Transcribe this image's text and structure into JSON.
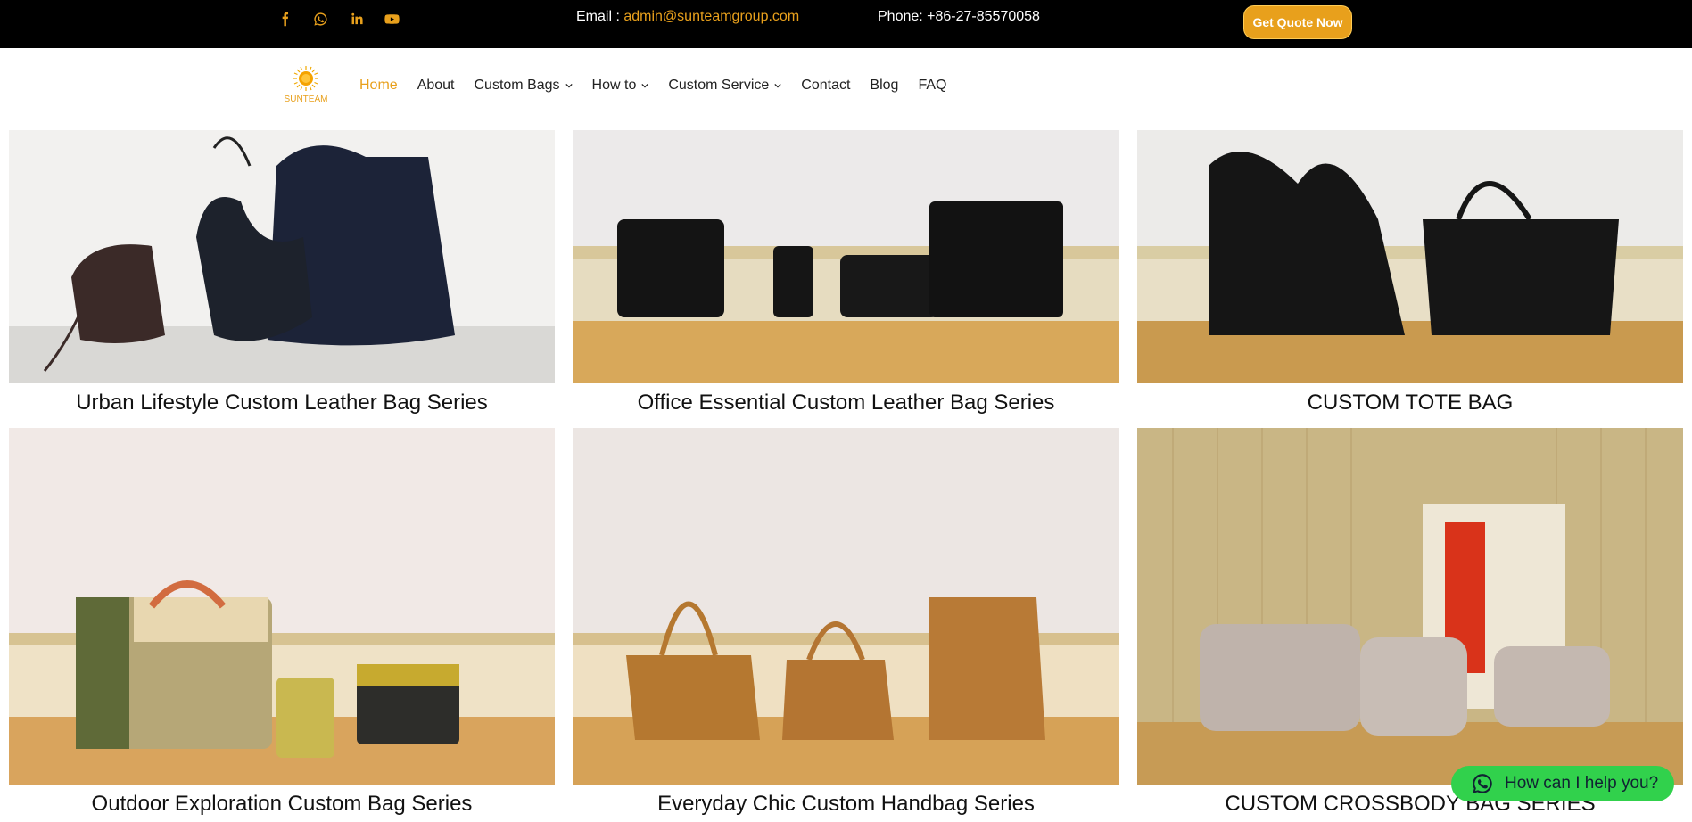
{
  "topbar": {
    "social": [
      {
        "icon": "facebook-icon"
      },
      {
        "icon": "whatsapp-icon"
      },
      {
        "icon": "linkedin-icon"
      },
      {
        "icon": "youtube-icon"
      }
    ],
    "email_label": "Email :",
    "email_value": "admin@sunteamgroup.com",
    "phone_label": "Phone: +86-27-85570058",
    "quote_button": "Get Quote Now",
    "accent_color": "#e8a01c"
  },
  "logo": {
    "text": "SUNTEAM"
  },
  "nav": {
    "items": [
      {
        "label": "Home",
        "active": true
      },
      {
        "label": "About"
      },
      {
        "label": "Custom Bags",
        "dropdown": true
      },
      {
        "label": "How to",
        "dropdown": true
      },
      {
        "label": "Custom Service",
        "dropdown": true
      },
      {
        "label": "Contact"
      },
      {
        "label": "Blog"
      },
      {
        "label": "FAQ"
      }
    ]
  },
  "products": [
    {
      "title": "Urban Lifestyle Custom Leather Bag Series"
    },
    {
      "title": "Office Essential Custom Leather Bag Series"
    },
    {
      "title": "CUSTOM TOTE BAG"
    },
    {
      "title": "Outdoor Exploration Custom Bag Series"
    },
    {
      "title": "Everyday Chic Custom Handbag Series"
    },
    {
      "title": "CUSTOM CROSSBODY BAG SERIES"
    }
  ],
  "chat": {
    "label": "How can I help you?",
    "color": "#31d14c"
  }
}
